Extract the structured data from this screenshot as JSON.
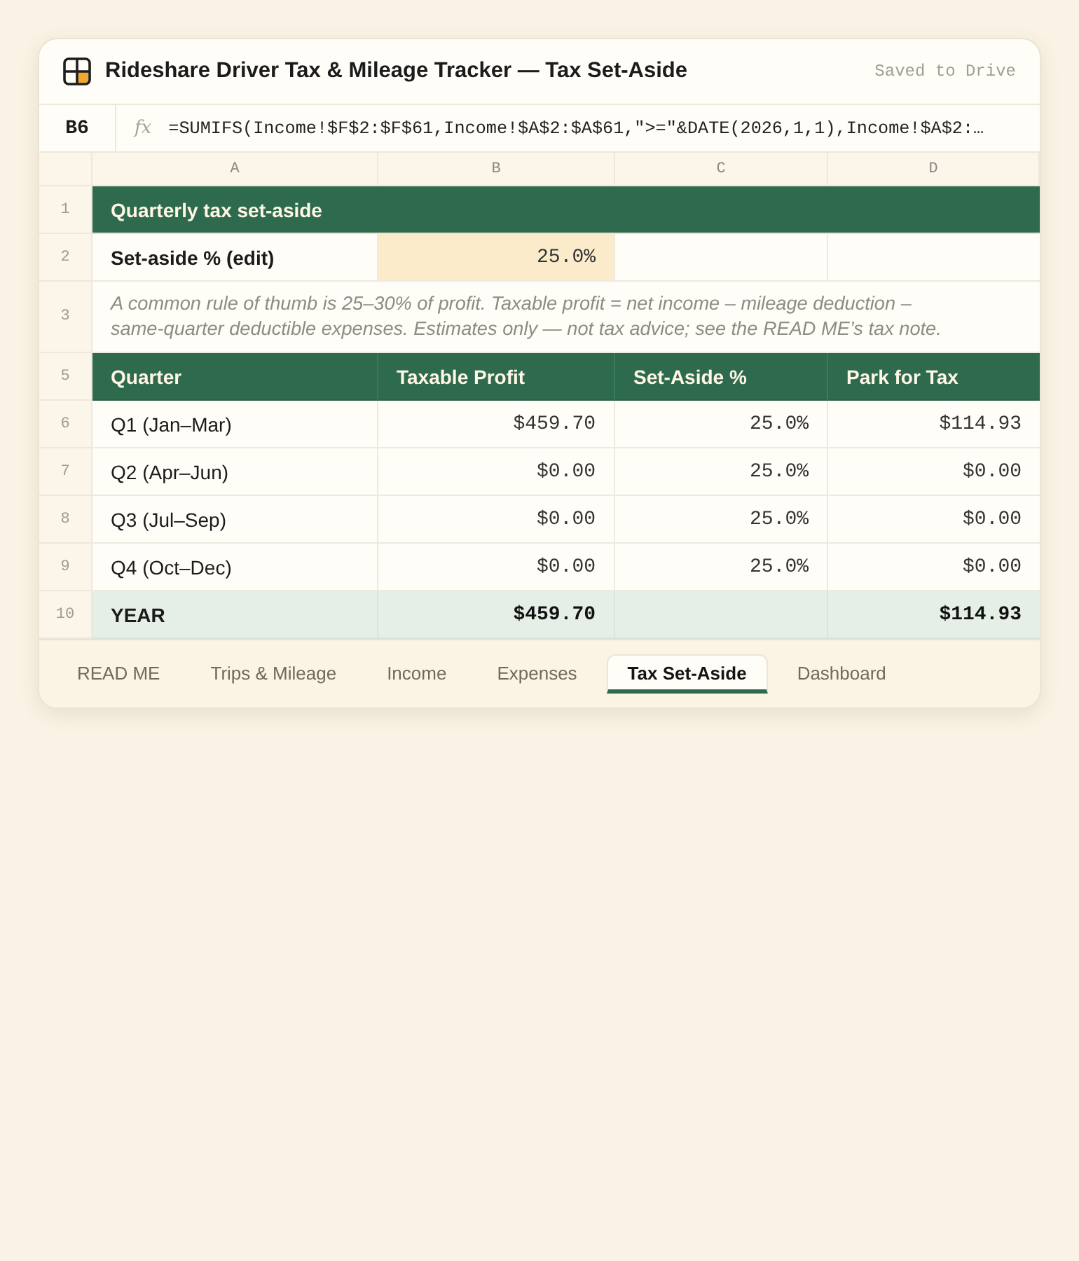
{
  "window": {
    "title": "Rideshare Driver Tax & Mileage Tracker — Tax Set-Aside",
    "status": "Saved to Drive"
  },
  "formula_bar": {
    "cell_ref": "B6",
    "function_symbol": "fx",
    "formula": "=SUMIFS(Income!$F$2:$F$61,Income!$A$2:$A$61,\">=\"&DATE(2026,1,1),Income!$A$2:…"
  },
  "columns": [
    "A",
    "B",
    "C",
    "D"
  ],
  "rows": [
    {
      "number": "1",
      "kind": "title",
      "text": "Quarterly tax set-aside"
    },
    {
      "number": "2",
      "kind": "input",
      "label": "Set-aside % (edit)",
      "value": "25.0%"
    },
    {
      "number": "3",
      "kind": "note",
      "text": "A common rule of thumb is 25–30% of profit. Taxable profit = net income – mileage deduction – same-quarter deductible expenses. Estimates only — not tax advice; see the READ ME’s tax note."
    },
    {
      "number": "5",
      "kind": "header",
      "cells": [
        "Quarter",
        "Taxable Profit",
        "Set-Aside %",
        "Park for Tax"
      ]
    },
    {
      "number": "6",
      "kind": "data",
      "cells": [
        "Q1 (Jan–Mar)",
        "$459.70",
        "25.0%",
        "$114.93"
      ]
    },
    {
      "number": "7",
      "kind": "data",
      "cells": [
        "Q2 (Apr–Jun)",
        "$0.00",
        "25.0%",
        "$0.00"
      ]
    },
    {
      "number": "8",
      "kind": "data",
      "cells": [
        "Q3 (Jul–Sep)",
        "$0.00",
        "25.0%",
        "$0.00"
      ]
    },
    {
      "number": "9",
      "kind": "data",
      "cells": [
        "Q4 (Oct–Dec)",
        "$0.00",
        "25.0%",
        "$0.00"
      ]
    },
    {
      "number": "10",
      "kind": "total",
      "label": "YEAR",
      "taxable_profit": "$459.70",
      "park_for_tax": "$114.93"
    }
  ],
  "tabs": [
    {
      "label": "READ ME",
      "selected": false
    },
    {
      "label": "Trips & Mileage",
      "selected": false
    },
    {
      "label": "Income",
      "selected": false
    },
    {
      "label": "Expenses",
      "selected": false
    },
    {
      "label": "Tax Set-Aside",
      "selected": true
    },
    {
      "label": "Dashboard",
      "selected": false
    }
  ]
}
